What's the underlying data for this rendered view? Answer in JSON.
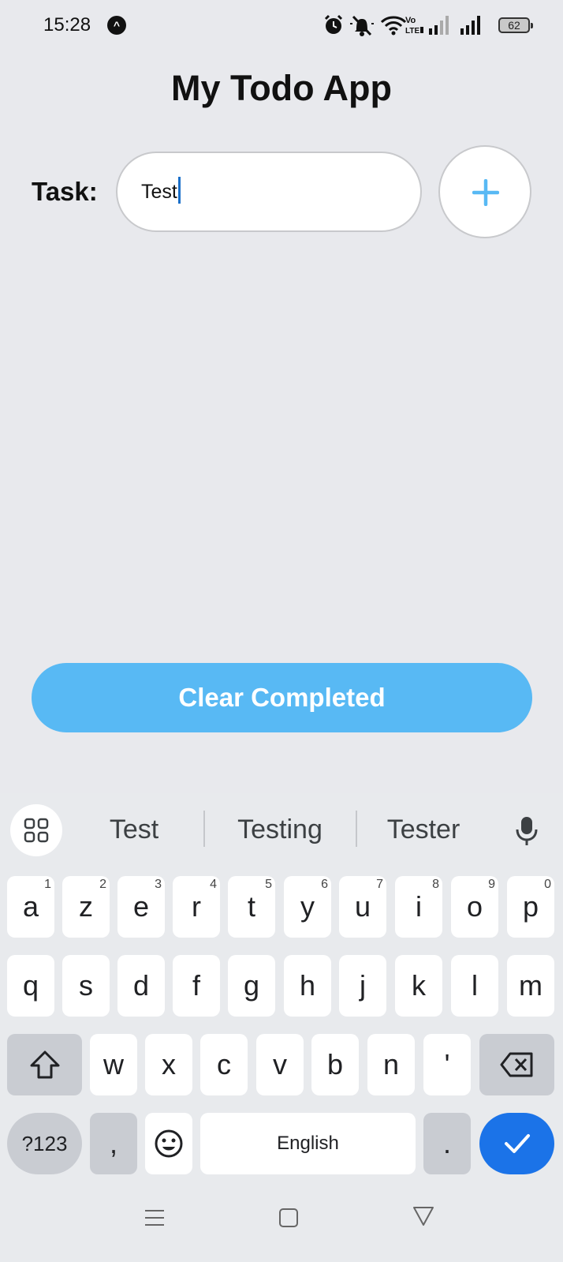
{
  "status_bar": {
    "time": "15:28",
    "notification_badge": "^",
    "battery": "62",
    "icons": [
      "alarm-icon",
      "mute-icon",
      "wifi-icon",
      "volte-icon",
      "signal-icon",
      "signal-icon",
      "battery-icon"
    ]
  },
  "app": {
    "title": "My Todo App",
    "task_label": "Task:",
    "task_input_value": "Test",
    "add_button": "+",
    "clear_button": "Clear Completed",
    "accent_color": "#58b9f4"
  },
  "keyboard": {
    "suggestions": [
      "Test",
      "Testing",
      "Tester"
    ],
    "row1": [
      {
        "key": "a",
        "hint": "1"
      },
      {
        "key": "z",
        "hint": "2"
      },
      {
        "key": "e",
        "hint": "3"
      },
      {
        "key": "r",
        "hint": "4"
      },
      {
        "key": "t",
        "hint": "5"
      },
      {
        "key": "y",
        "hint": "6"
      },
      {
        "key": "u",
        "hint": "7"
      },
      {
        "key": "i",
        "hint": "8"
      },
      {
        "key": "o",
        "hint": "9"
      },
      {
        "key": "p",
        "hint": "0"
      }
    ],
    "row2": [
      "q",
      "s",
      "d",
      "f",
      "g",
      "h",
      "j",
      "k",
      "l",
      "m"
    ],
    "row3": [
      "w",
      "x",
      "c",
      "v",
      "b",
      "n",
      "'"
    ],
    "symbols_key": "?123",
    "comma_key": ",",
    "space_key": "English",
    "period_key": ".",
    "enter_color": "#1b73e8"
  },
  "nav_bar": [
    "menu-icon",
    "home-icon",
    "back-icon"
  ]
}
